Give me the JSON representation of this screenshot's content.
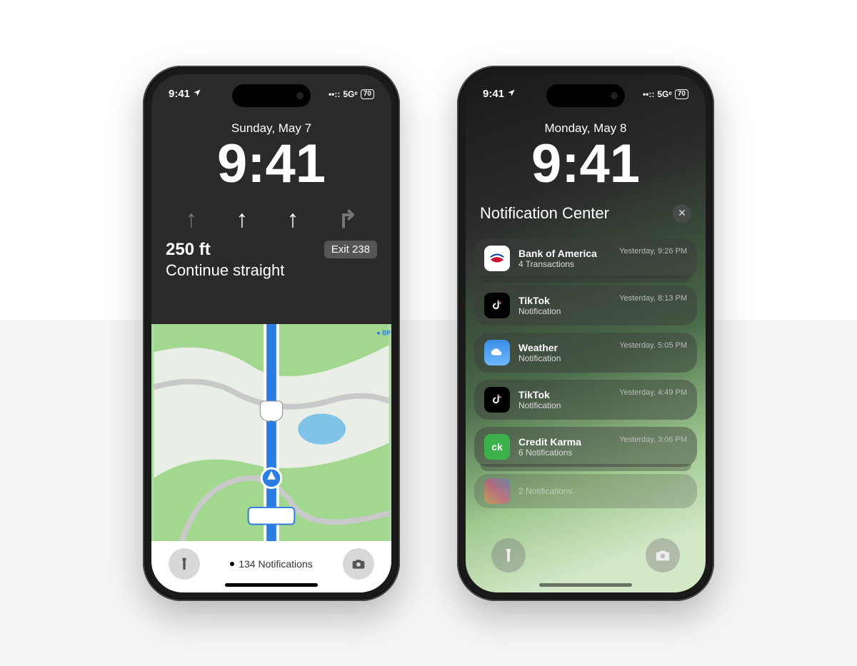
{
  "statusbar": {
    "time": "9:41",
    "signal": "••::",
    "network": "5Gᵉ",
    "battery": "70"
  },
  "phone1": {
    "date": "Sunday, May 7",
    "clock": "9:41",
    "nav": {
      "distance": "250 ft",
      "exit": "Exit 238",
      "instruction": "Continue straight",
      "map_label": "BP"
    },
    "bottom": {
      "notif_text": "134 Notifications"
    }
  },
  "phone2": {
    "date": "Monday, May 8",
    "clock": "9:41",
    "nc_title": "Notification Center",
    "notifications": [
      {
        "app": "Bank of America",
        "sub": "4 Transactions",
        "time": "Yesterday, 9:26 PM"
      },
      {
        "app": "TikTok",
        "sub": "Notification",
        "time": "Yesterday, 8:13 PM"
      },
      {
        "app": "Weather",
        "sub": "Notification",
        "time": "Yesterday, 5:05 PM"
      },
      {
        "app": "TikTok",
        "sub": "Notification",
        "time": "Yesterday, 4:49 PM"
      },
      {
        "app": "Credit Karma",
        "sub": "6 Notifications",
        "time": "Yesterday, 3:06 PM"
      },
      {
        "app": "",
        "sub": "2 Notifications",
        "time": ""
      }
    ]
  }
}
